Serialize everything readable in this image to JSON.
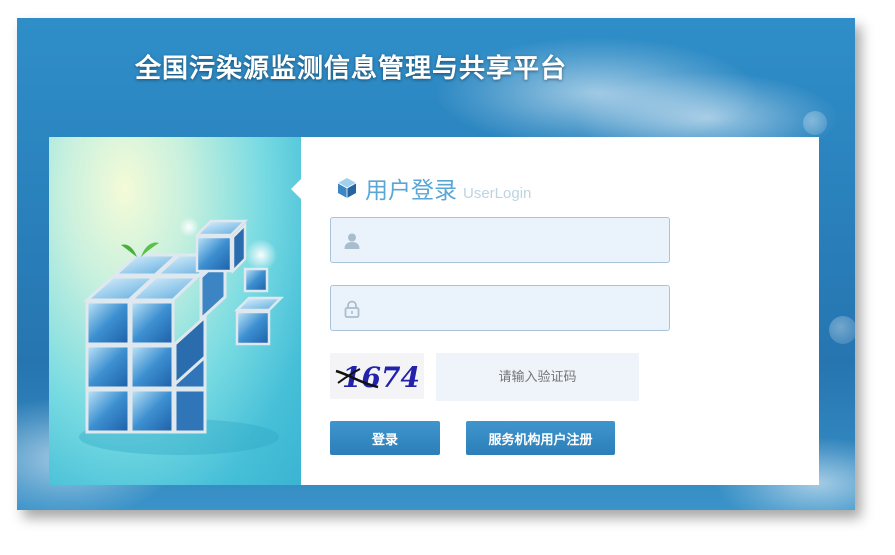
{
  "site": {
    "title": "全国污染源监测信息管理与共享平台"
  },
  "login": {
    "heading_cn": "用户登录",
    "heading_en": "UserLogin",
    "username": {
      "value": "",
      "placeholder": ""
    },
    "password": {
      "value": "",
      "placeholder": ""
    },
    "captcha": {
      "image_text": "1674",
      "placeholder": "请输入验证码"
    },
    "login_button": "登录",
    "register_button": "服务机构用户注册"
  },
  "icons": {
    "username": "user-icon",
    "password": "lock-icon",
    "heading": "cube-icon"
  },
  "colors": {
    "frame_blue": "#2a82bd",
    "button_blue": "#3a8fc8",
    "heading_blue": "#5aa7d6",
    "field_bg": "#eaf3fb"
  }
}
